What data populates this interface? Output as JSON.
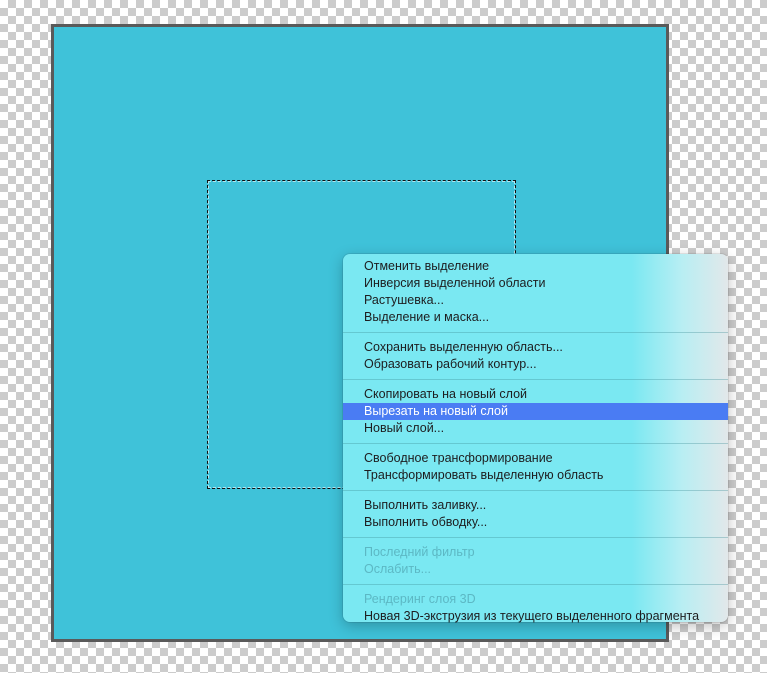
{
  "colors": {
    "canvas_fill": "#3fc2d9",
    "canvas_border": "#5a5a5a",
    "menu_background": "#7ae8f2",
    "highlight": "#4a7cf3",
    "disabled_text": "#5cb8c4"
  },
  "context_menu": {
    "groups": [
      [
        "Отменить выделение",
        "Инверсия выделенной области",
        "Растушевка...",
        "Выделение и маска..."
      ],
      [
        "Сохранить выделенную область...",
        "Образовать рабочий контур..."
      ],
      [
        "Скопировать на новый слой",
        "Вырезать на новый слой",
        "Новый слой..."
      ],
      [
        "Свободное трансформирование",
        "Трансформировать выделенную область"
      ],
      [
        "Выполнить заливку...",
        "Выполнить обводку..."
      ],
      [
        "Последний фильтр",
        "Ослабить..."
      ],
      [
        "Рендеринг слоя 3D",
        "Новая 3D-экструзия из текущего выделенного фрагмента"
      ]
    ],
    "highlighted_item": "Вырезать на новый слой",
    "disabled_items": [
      "Последний фильтр",
      "Ослабить...",
      "Рендеринг слоя 3D"
    ]
  }
}
